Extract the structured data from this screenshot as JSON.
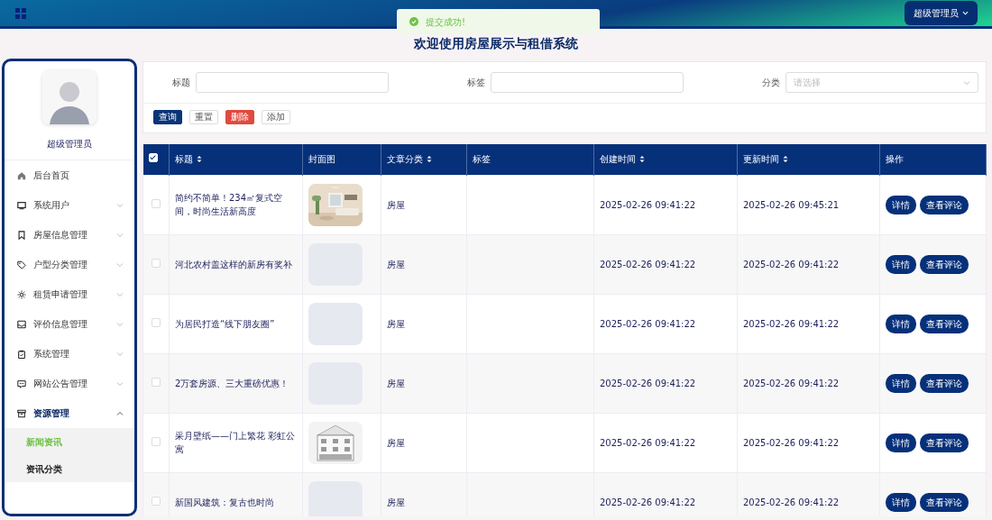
{
  "header": {
    "user_menu": "超级管理员"
  },
  "toast": {
    "message": "提交成功!"
  },
  "page_title": "欢迎使用房屋展示与租借系统",
  "sidebar": {
    "user_name": "超级管理员",
    "items": [
      {
        "label": "后台首页",
        "has_children": false,
        "expanded": false
      },
      {
        "label": "系统用户",
        "has_children": true,
        "expanded": false
      },
      {
        "label": "房屋信息管理",
        "has_children": true,
        "expanded": false
      },
      {
        "label": "户型分类管理",
        "has_children": true,
        "expanded": false
      },
      {
        "label": "租赁申请管理",
        "has_children": true,
        "expanded": false
      },
      {
        "label": "评价信息管理",
        "has_children": true,
        "expanded": false
      },
      {
        "label": "系统管理",
        "has_children": true,
        "expanded": false
      },
      {
        "label": "网站公告管理",
        "has_children": true,
        "expanded": false
      },
      {
        "label": "资源管理",
        "has_children": true,
        "expanded": true,
        "children": [
          {
            "label": "新闻资讯",
            "selected": true
          },
          {
            "label": "资讯分类",
            "selected": false
          }
        ]
      }
    ]
  },
  "search": {
    "fields": [
      {
        "label": "标题",
        "kind": "text"
      },
      {
        "label": "标签",
        "kind": "text"
      },
      {
        "label": "分类",
        "kind": "select",
        "placeholder": "请选择"
      }
    ],
    "buttons": [
      {
        "label": "查询",
        "kind": "primary"
      },
      {
        "label": "重置",
        "kind": "plain"
      },
      {
        "label": "删除",
        "kind": "danger"
      },
      {
        "label": "添加",
        "kind": "plain"
      }
    ]
  },
  "table": {
    "select_all": {
      "checked": true
    },
    "columns": [
      {
        "label": "标题",
        "sortable": true
      },
      {
        "label": "封面图",
        "sortable": false
      },
      {
        "label": "文章分类",
        "sortable": true
      },
      {
        "label": "标签",
        "sortable": false
      },
      {
        "label": "创建时间",
        "sortable": true
      },
      {
        "label": "更新时间",
        "sortable": true
      },
      {
        "label": "操作",
        "sortable": false
      }
    ],
    "rows": [
      {
        "checked": false,
        "title": "简约不简单！234㎡复式空间，时尚生活新高度",
        "cover": {
          "kind": "room"
        },
        "category": "房屋",
        "created": "2025-02-26 09:41:22",
        "updated": "2025-02-26 09:45:21",
        "actions": [
          "详情",
          "查看评论"
        ]
      },
      {
        "checked": false,
        "title": "河北农村盖这样的新房有奖补",
        "cover": {
          "kind": "empty"
        },
        "category": "房屋",
        "created": "2025-02-26 09:41:22",
        "updated": "2025-02-26 09:41:22",
        "actions": [
          "详情",
          "查看评论"
        ]
      },
      {
        "checked": false,
        "title": "为居民打造“线下朋友圈”",
        "cover": {
          "kind": "empty"
        },
        "category": "房屋",
        "created": "2025-02-26 09:41:22",
        "updated": "2025-02-26 09:41:22",
        "actions": [
          "详情",
          "查看评论"
        ]
      },
      {
        "checked": false,
        "title": "2万套房源、三大重磅优惠！",
        "cover": {
          "kind": "empty"
        },
        "category": "房屋",
        "created": "2025-02-26 09:41:22",
        "updated": "2025-02-26 09:41:22",
        "actions": [
          "详情",
          "查看评论"
        ]
      },
      {
        "checked": false,
        "title": "采月壁纸——门上繁花 彩虹公寓",
        "cover": {
          "kind": "sketch"
        },
        "category": "房屋",
        "created": "2025-02-26 09:41:22",
        "updated": "2025-02-26 09:41:22",
        "actions": [
          "详情",
          "查看评论"
        ]
      },
      {
        "checked": false,
        "title": "新国风建筑：复古也时尚",
        "cover": {
          "kind": "empty"
        },
        "category": "房屋",
        "created": "2025-02-26 09:41:22",
        "updated": "2025-02-26 09:41:22",
        "actions": [
          "详情",
          "查看评论"
        ]
      }
    ]
  }
}
